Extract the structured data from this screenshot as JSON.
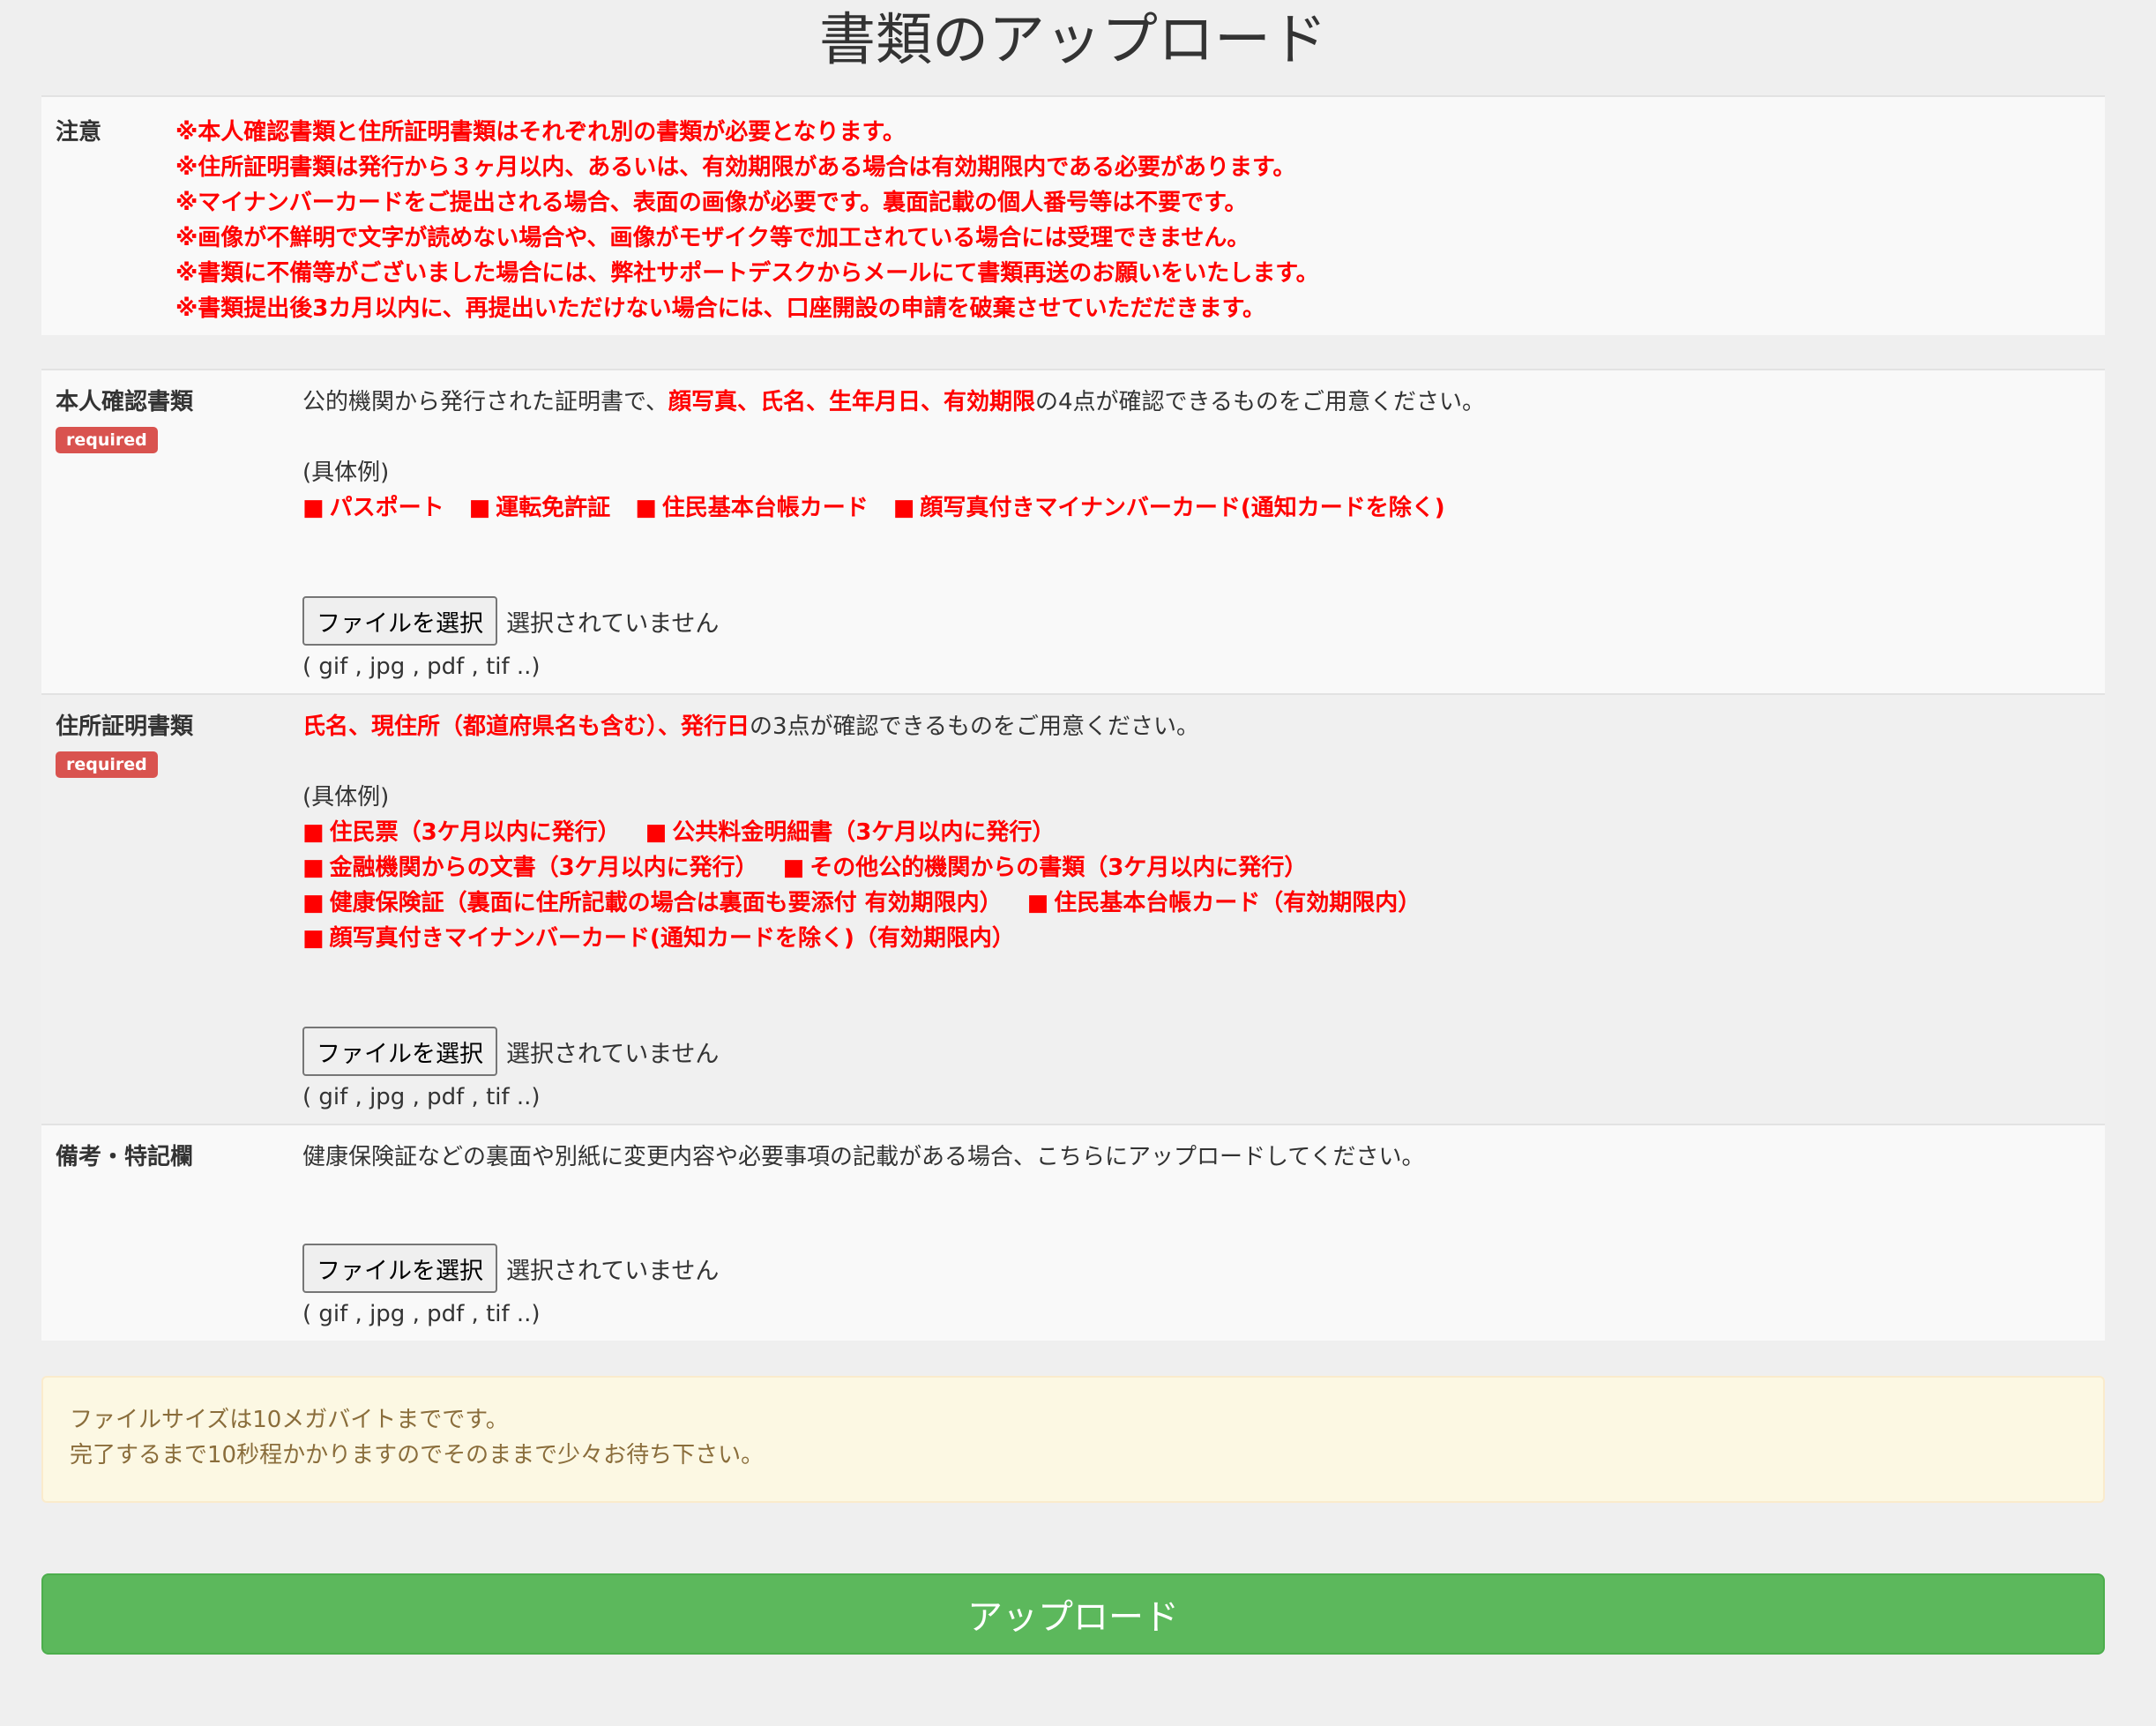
{
  "page": {
    "title": "書類のアップロード"
  },
  "notice": {
    "label": "注意",
    "lines": [
      "※本人確認書類と住所証明書類はそれぞれ別の書類が必要となります。",
      "※住所証明書類は発行から３ヶ月以内、あるいは、有効期限がある場合は有効期限内である必要があります。",
      "※マイナンバーカードをご提出される場合、表面の画像が必要です。裏面記載の個人番号等は不要です。",
      "※画像が不鮮明で文字が読めない場合や、画像がモザイク等で加工されている場合には受理できません。",
      "※書類に不備等がございました場合には、弊社サポートデスクからメールにて書類再送のお願いをいたします。",
      "※書類提出後3カ月以内に、再提出いただけない場合には、口座開設の申請を破棄させていただだきます。"
    ]
  },
  "identity": {
    "label": "本人確認書類",
    "badge": "required",
    "desc_prefix": "公的機関から発行された証明書で、",
    "desc_highlight": "顔写真、氏名、生年月日、有効期限",
    "desc_suffix": "の4点が確認できるものをご用意ください。",
    "example_title": "(具体例)",
    "example_lines": [
      [
        "パスポート",
        "運転免許証",
        "住民基本台帳カード",
        "顔写真付きマイナンバーカード(通知カードを除く)"
      ]
    ],
    "file_button": "ファイルを選択",
    "file_status": "選択されていません",
    "file_hint": "( gif , jpg , pdf , tif ..)"
  },
  "address": {
    "label": "住所証明書類",
    "badge": "required",
    "desc_highlight": "氏名、現住所（都道府県名も含む）、発行日",
    "desc_suffix": "の3点が確認できるものをご用意ください。",
    "example_title": "(具体例)",
    "example_lines": [
      [
        "住民票（3ケ月以内に発行）",
        "公共料金明細書（3ケ月以内に発行）"
      ],
      [
        "金融機関からの文書（3ケ月以内に発行）",
        "その他公的機関からの書類（3ケ月以内に発行）"
      ],
      [
        "健康保険証（裏面に住所記載の場合は裏面も要添付 有効期限内）",
        "住民基本台帳カード（有効期限内）"
      ],
      [
        "顔写真付きマイナンバーカード(通知カードを除く)（有効期限内）"
      ]
    ],
    "file_button": "ファイルを選択",
    "file_status": "選択されていません",
    "file_hint": "( gif , jpg , pdf , tif ..)"
  },
  "remarks": {
    "label": "備考・特記欄",
    "desc": "健康保険証などの裏面や別紙に変更内容や必要事項の記載がある場合、こちらにアップロードしてください。",
    "file_button": "ファイルを選択",
    "file_status": "選択されていません",
    "file_hint": "( gif , jpg , pdf , tif ..)"
  },
  "alert": {
    "line1": "ファイルサイズは10メガバイトまでです。",
    "line2": "完了するまで10秒程かかりますのでそのままで少々お待ち下さい。"
  },
  "submit": {
    "label": "アップロード"
  },
  "colors": {
    "highlight": "#ff0000",
    "badge": "#d9534f",
    "submit": "#5cb85c",
    "alert_bg": "#fcf8e3"
  },
  "icons": {
    "bullet": "■"
  }
}
